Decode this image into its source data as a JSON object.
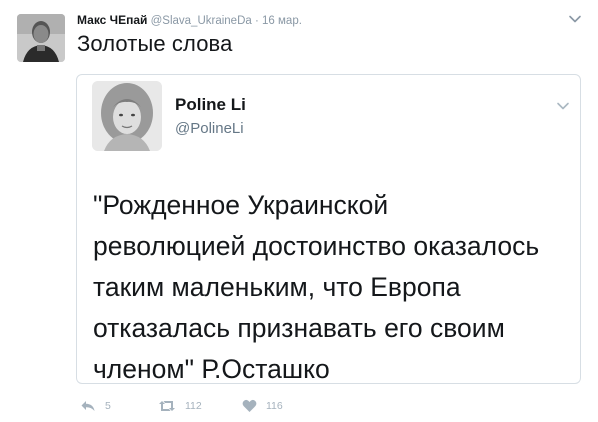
{
  "tweet": {
    "author_name": "Макс ЧЕпай",
    "handle": "@Slava_UkraineDa",
    "separator": "·",
    "timestamp": "16 мар.",
    "text": "Золотые слова",
    "avatar_icon": "person-photo-avatar",
    "menu_icon": "chevron-down-icon"
  },
  "quote": {
    "author_name": "Poline Li",
    "handle": "@PolineLi",
    "lines": [
      "\"Рожденное Украинской",
      "революцией достоинство оказалось",
      "таким маленьким, что Европа",
      "отказалась признавать его своим",
      "членом\" Р.Осташко"
    ],
    "avatar_icon": "person-photo-avatar",
    "menu_icon": "chevron-down-icon"
  },
  "actions": {
    "reply_count": "5",
    "retweet_count": "112",
    "like_count": "116",
    "reply_icon": "reply-icon",
    "retweet_icon": "retweet-icon",
    "like_icon": "heart-icon",
    "color": "#a5b2bd"
  }
}
